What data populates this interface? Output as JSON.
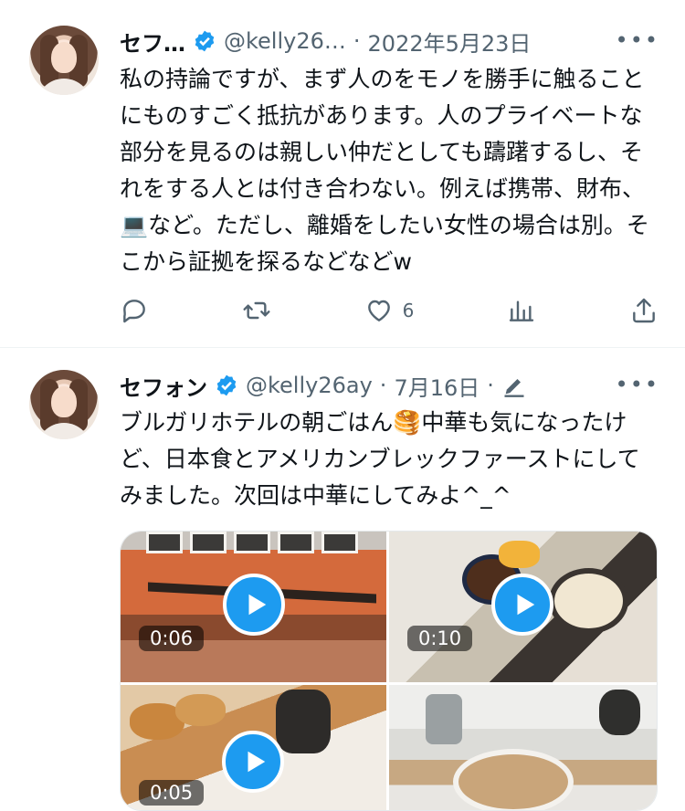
{
  "tweets": [
    {
      "name": "セフ…",
      "handle": "@kelly26…",
      "separator": "·",
      "date": "2022年5月23日",
      "text": "私の持論ですが、まず人のをモノを勝手に触ることにものすごく抵抗があります。人のプライベートな部分を見るのは親しい仲だとしても躊躇するし、それをする人とは付き合わない。例えば携帯、財布、💻など。ただし、離婚をしたい女性の場合は別。そこから証拠を探るなどなどw",
      "actions": {
        "reply": "",
        "retweet": "",
        "like_count": "6",
        "views": ""
      }
    },
    {
      "name": "セフォン",
      "handle": "@kelly26ay",
      "separator": "·",
      "date": "7月16日",
      "separator2": "·",
      "text": "ブルガリホテルの朝ごはん🥞中華も気になったけど、日本食とアメリカンブレックファーストにしてみました。次回は中華にしてみよ^_^",
      "media": [
        {
          "duration": "0:06"
        },
        {
          "duration": "0:10"
        },
        {
          "duration": "0:05"
        },
        {
          "duration": ""
        }
      ]
    }
  ],
  "colors": {
    "accent": "#1d9bf0",
    "secondary_text": "#536471",
    "text": "#0f1419"
  },
  "icons": [
    "verified-badge-icon",
    "more-icon",
    "reply-icon",
    "retweet-icon",
    "like-icon",
    "views-icon",
    "share-icon",
    "edit-icon",
    "play-icon"
  ]
}
